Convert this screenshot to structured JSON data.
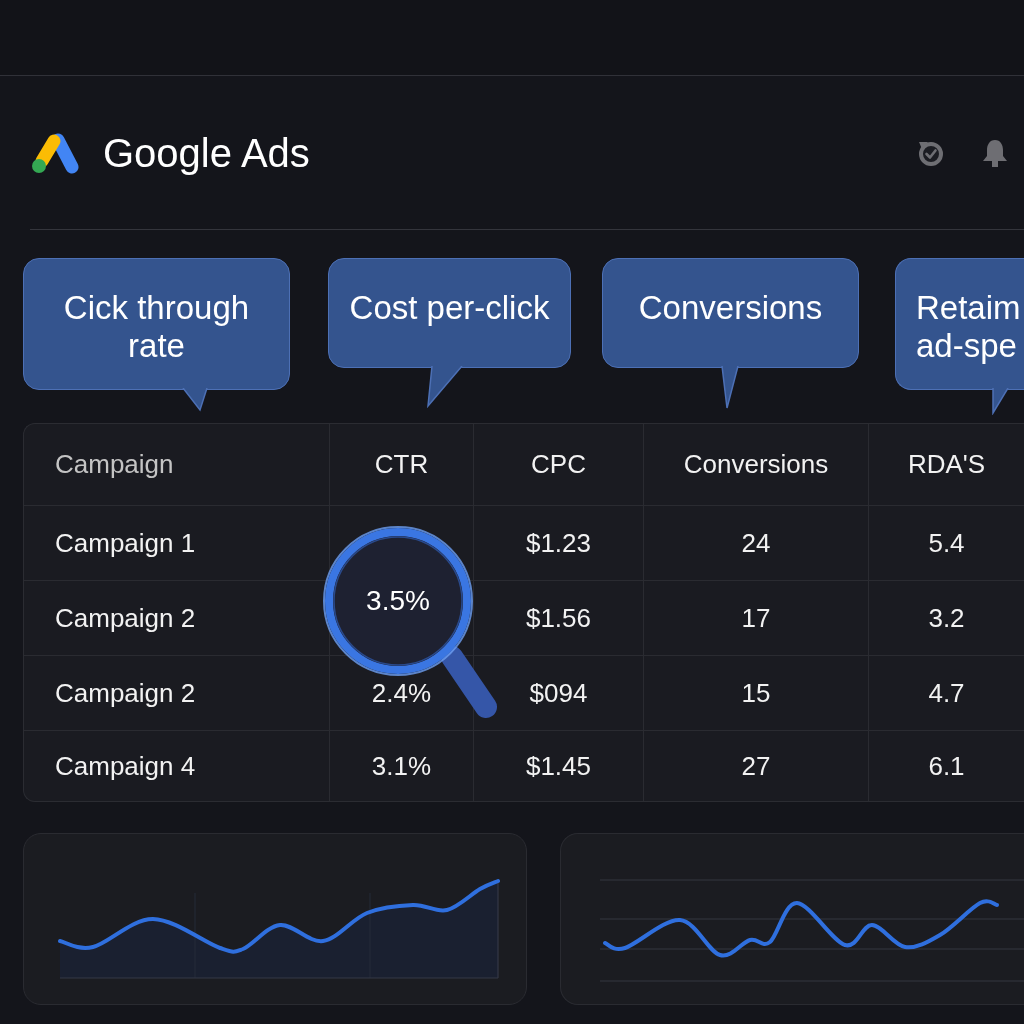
{
  "header": {
    "title": "Google Ads"
  },
  "callouts": [
    {
      "text": "Cick through rate"
    },
    {
      "text": "Cost per-click"
    },
    {
      "text": "Conversions"
    },
    {
      "text": "Retaim ad-spe"
    }
  ],
  "table": {
    "columns": [
      "Campaign",
      "CTR",
      "CPC",
      "Conversions",
      "RDA'S"
    ],
    "rows": [
      [
        "Campaign 1",
        null,
        "$1.23",
        "24",
        "5.4"
      ],
      [
        "Campaign 2",
        null,
        "$1.56",
        "17",
        "3.2"
      ],
      [
        "Campaign 2",
        "2.4%",
        "$094",
        "15",
        "4.7"
      ],
      [
        "Campaign 4",
        "3.1%",
        "$1.45",
        "27",
        "6.1"
      ]
    ],
    "magnifier": {
      "value": "3.5%"
    }
  },
  "charts": [
    {
      "kind": "area"
    },
    {
      "kind": "line"
    }
  ]
}
